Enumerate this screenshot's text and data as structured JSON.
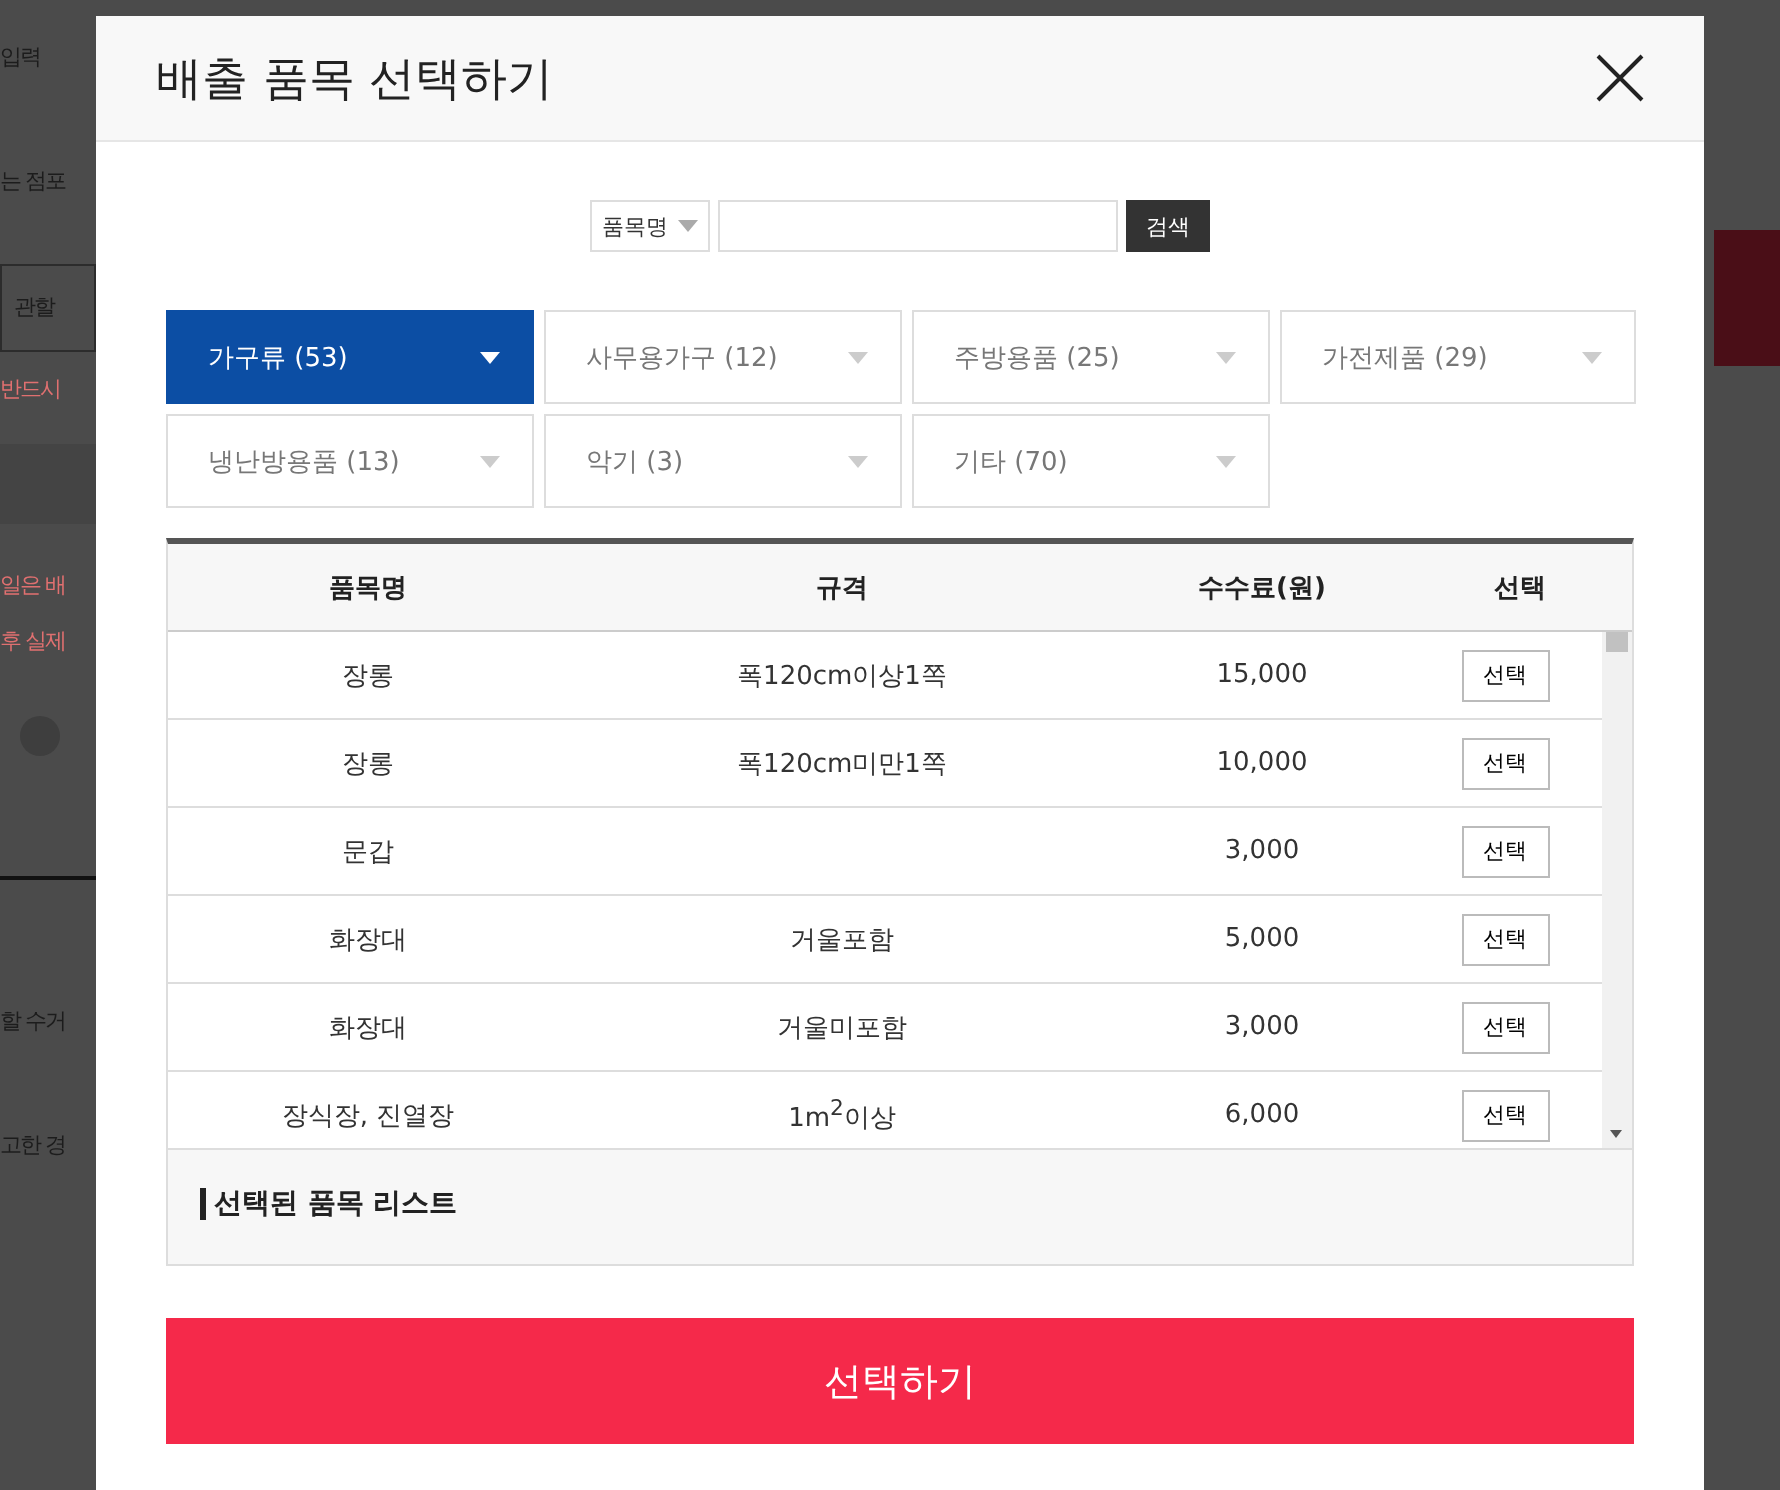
{
  "background_page": {
    "fragments": [
      {
        "kind": "text",
        "text": "입력"
      },
      {
        "kind": "text",
        "text": "는 점포"
      },
      {
        "kind": "box",
        "text": "관할"
      },
      {
        "kind": "alert",
        "text": "반드시"
      },
      {
        "kind": "band"
      },
      {
        "kind": "alert",
        "text": "일은 배"
      },
      {
        "kind": "alert",
        "text": "후 실제"
      },
      {
        "kind": "radio",
        "checked": false
      },
      {
        "kind": "rule"
      },
      {
        "kind": "text",
        "text": "할 수거"
      },
      {
        "kind": "text",
        "text": "고한 경"
      }
    ]
  },
  "modal": {
    "title": "배출 품목 선택하기",
    "search": {
      "filter": "품목명",
      "button": "검색"
    },
    "categories": [
      {
        "label": "가구류 (53)",
        "selected": true
      },
      {
        "label": "사무용가구 (12)",
        "selected": false
      },
      {
        "label": "주방용품 (25)",
        "selected": false
      },
      {
        "label": "가전제품 (29)",
        "selected": false
      },
      {
        "label": "냉난방용품 (13)",
        "selected": false
      },
      {
        "label": "악기 (3)",
        "selected": false
      },
      {
        "label": "기타 (70)",
        "selected": false
      }
    ],
    "table": {
      "columns": [
        "품목명",
        "규격",
        "수수료(원)",
        "선택"
      ],
      "rows": [
        {
          "name": "장롱",
          "spec": "폭120cm이상1쪽",
          "fee": "15,000",
          "button": "선택"
        },
        {
          "name": "장롱",
          "spec": "폭120cm미만1쪽",
          "fee": "10,000",
          "button": "선택"
        },
        {
          "name": "문갑",
          "fee": "3,000",
          "button": "선택"
        },
        {
          "name": "화장대",
          "spec": "거울포함",
          "fee": "5,000",
          "button": "선택"
        },
        {
          "name": "화장대",
          "spec": "거울미포함",
          "fee": "3,000",
          "button": "선택"
        },
        {
          "name": "장식장, 진열장",
          "spec": "1m$^{2}$이상",
          "fee": "6,000",
          "button": "선택"
        }
      ]
    },
    "selected_list": {
      "title": "선택된 품목 리스트"
    },
    "submit": "선택하기"
  }
}
